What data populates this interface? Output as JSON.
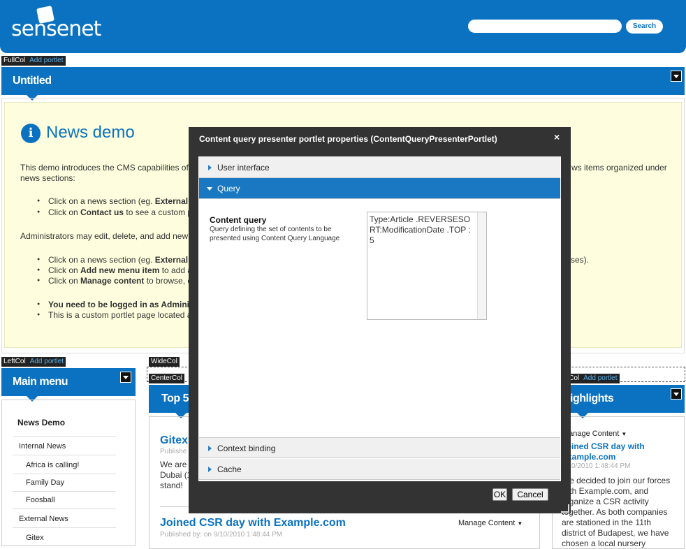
{
  "header": {
    "logo": "sensenet",
    "search_button": "Search",
    "search_placeholder": ""
  },
  "zones": {
    "fullcol": "FullCol",
    "leftcol": "LeftCol",
    "widecol": "WideCol",
    "centercol": "CenterCol",
    "rightcol": "ightCol",
    "add_portlet": "Add portlet"
  },
  "untitled": {
    "title": "Untitled"
  },
  "news": {
    "title": "News demo",
    "intro": "This demo introduces the CMS capabilities of S",
    "intro_right": "ws items organized under",
    "intro2": "news sections:",
    "b1_pre": "Click on a news section (eg. ",
    "b1_bold": "External n",
    "b2_pre": "Click on ",
    "b2_bold": "Contact us",
    "b2_post": " to see a custom po",
    "admin": "Administrators may edit, delete, and add new n",
    "b3_pre": "Click on a news section (eg. ",
    "b3_bold": "External n",
    "b3_right": "ses).",
    "b4_pre": "Click on ",
    "b4_bold": "Add new menu item",
    "b4_post": " to add a n",
    "b5_pre": "Click on ",
    "b5_bold": "Manage content",
    "b5_post": " to browse, ed",
    "b6_bold": "You need to be logged in as Administra",
    "b7": "This is a custom portlet page located at"
  },
  "main_menu": {
    "title": "Main menu",
    "items": [
      "News Demo",
      "Internal News",
      "Africa is calling!",
      "Family Day",
      "Foosball",
      "External News",
      "Gitex"
    ]
  },
  "center": {
    "title": "Top 5 la",
    "article1": {
      "title": "Gitex",
      "meta": "Publishe",
      "body1": "We are lo",
      "body2": "Dubai (17",
      "body3": "stand!"
    },
    "article2": {
      "title": "Joined CSR day with Example.com",
      "meta": "Published by:  on 9/10/2010 1:48:44 PM",
      "manage": "Manage Content"
    }
  },
  "right": {
    "title": "Highlights",
    "manage": "Manage Content",
    "article_title1": "Joined CSR day with",
    "article_title2": "Example.com",
    "meta": "9/10/2010 1:48:44 PM",
    "body": [
      "We decided to join our forces",
      "with Example.com, and",
      "organize a CSR activity",
      "together. As both companies",
      "are stationed in the 11th",
      "district of Budapest, we have",
      "chosen a local nursery"
    ]
  },
  "dialog": {
    "title": "Content query presenter portlet properties (ContentQueryPresenterPortlet)",
    "close": "×",
    "sections": [
      "User interface",
      "Query",
      "Context binding",
      "Cache"
    ],
    "field_label": "Content query",
    "field_desc1": "Query defining the set of contents to be",
    "field_desc2": "presented using Content Query Language",
    "field_value": "Type:Article .REVERSESORT:ModificationDate .TOP : 5",
    "ok": "OK",
    "cancel": "Cancel"
  },
  "colors": {
    "brand": "#0a72c0",
    "dialog_bg": "#333333",
    "note_bg": "#fefedf"
  }
}
